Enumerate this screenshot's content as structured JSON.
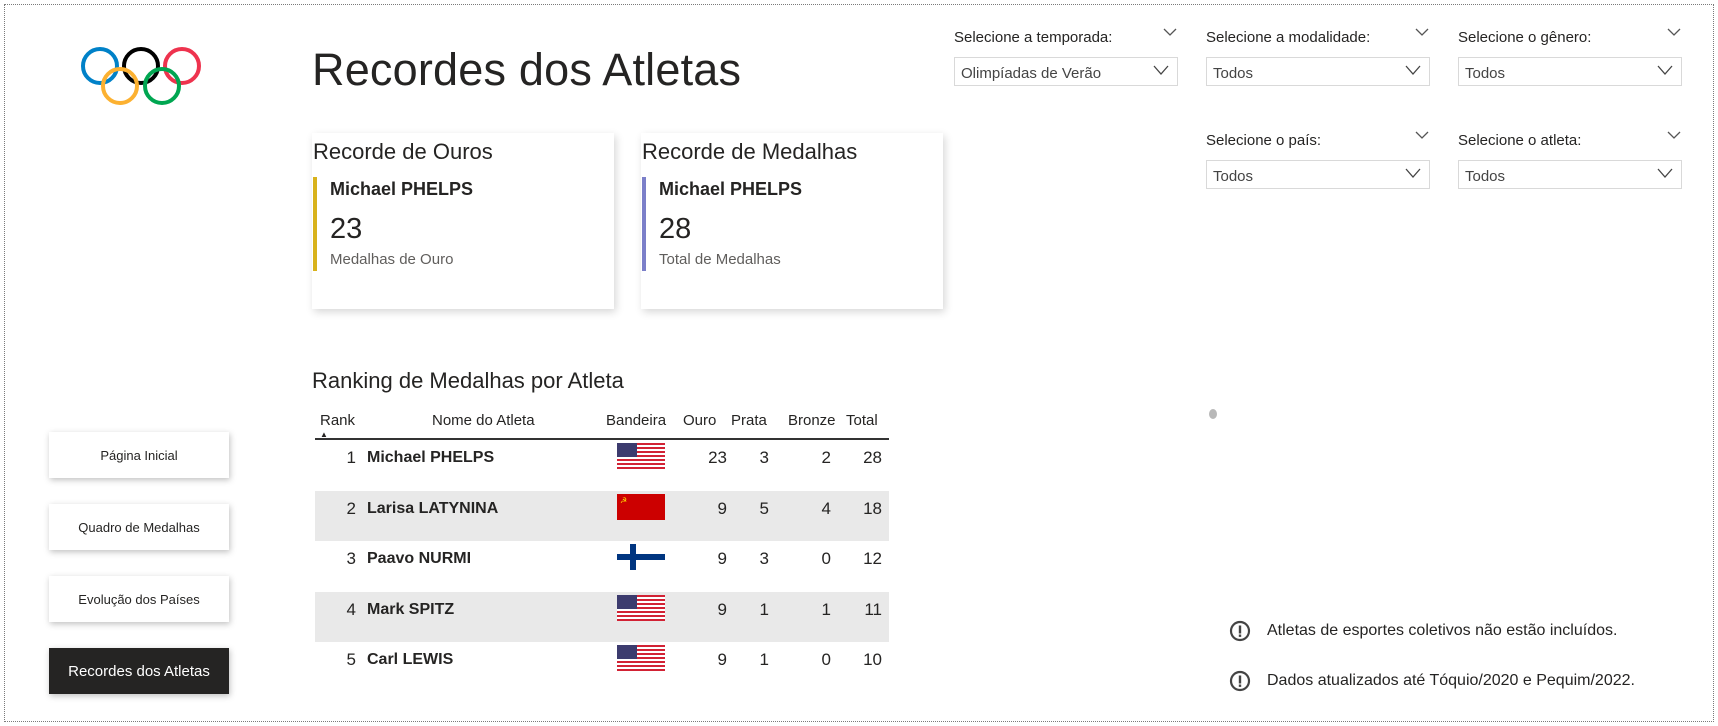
{
  "page": {
    "title": "Recordes dos Atletas"
  },
  "logo": {
    "icon": "olympic-rings-icon",
    "colors": [
      "#0081C8",
      "#FCB131",
      "#000000",
      "#00A651",
      "#EE334E"
    ]
  },
  "kpis": [
    {
      "title": "Recorde de Ouros",
      "athlete": "Michael PHELPS",
      "value": "23",
      "subtitle": "Medalhas de Ouro",
      "accent": "#D8B21B"
    },
    {
      "title": "Recorde de Medalhas",
      "athlete": "Michael PHELPS",
      "value": "28",
      "subtitle": "Total de Medalhas",
      "accent": "#7B7FC9"
    }
  ],
  "ranking": {
    "title": "Ranking de Medalhas por Atleta",
    "sort_icon": "sort-ascending-icon",
    "columns": {
      "rank": "Rank",
      "name": "Nome do Atleta",
      "flag": "Bandeira",
      "gold": "Ouro",
      "silver": "Prata",
      "bronze": "Bronze",
      "total": "Total"
    },
    "rows": [
      {
        "rank": "1",
        "name": "Michael PHELPS",
        "flag": "usa-flag-icon",
        "gold": "23",
        "silver": "3",
        "bronze": "2",
        "total": "28"
      },
      {
        "rank": "2",
        "name": "Larisa LATYNINA",
        "flag": "ussr-flag-icon",
        "gold": "9",
        "silver": "5",
        "bronze": "4",
        "total": "18"
      },
      {
        "rank": "3",
        "name": "Paavo NURMI",
        "flag": "finland-flag-icon",
        "gold": "9",
        "silver": "3",
        "bronze": "0",
        "total": "12"
      },
      {
        "rank": "4",
        "name": "Mark SPITZ",
        "flag": "usa-flag-icon",
        "gold": "9",
        "silver": "1",
        "bronze": "1",
        "total": "11"
      },
      {
        "rank": "5",
        "name": "Carl LEWIS",
        "flag": "usa-flag-icon",
        "gold": "9",
        "silver": "1",
        "bronze": "0",
        "total": "10"
      }
    ]
  },
  "slicers": {
    "season": {
      "label": "Selecione a temporada:",
      "value": "Olimpíadas de Verão"
    },
    "sport": {
      "label": "Selecione a modalidade:",
      "value": "Todos"
    },
    "gender": {
      "label": "Selecione o gênero:",
      "value": "Todos"
    },
    "country": {
      "label": "Selecione o país:",
      "value": "Todos"
    },
    "athlete": {
      "label": "Selecione o atleta:",
      "value": "Todos"
    }
  },
  "nav": {
    "home": "Página Inicial",
    "medals": "Quadro de Medalhas",
    "evolution": "Evolução dos Países",
    "records": "Recordes dos Atletas"
  },
  "notes": {
    "team_sports": "Atletas de esportes coletivos não estão incluídos.",
    "updated": "Dados atualizados até Tóquio/2020 e Pequim/2022."
  }
}
